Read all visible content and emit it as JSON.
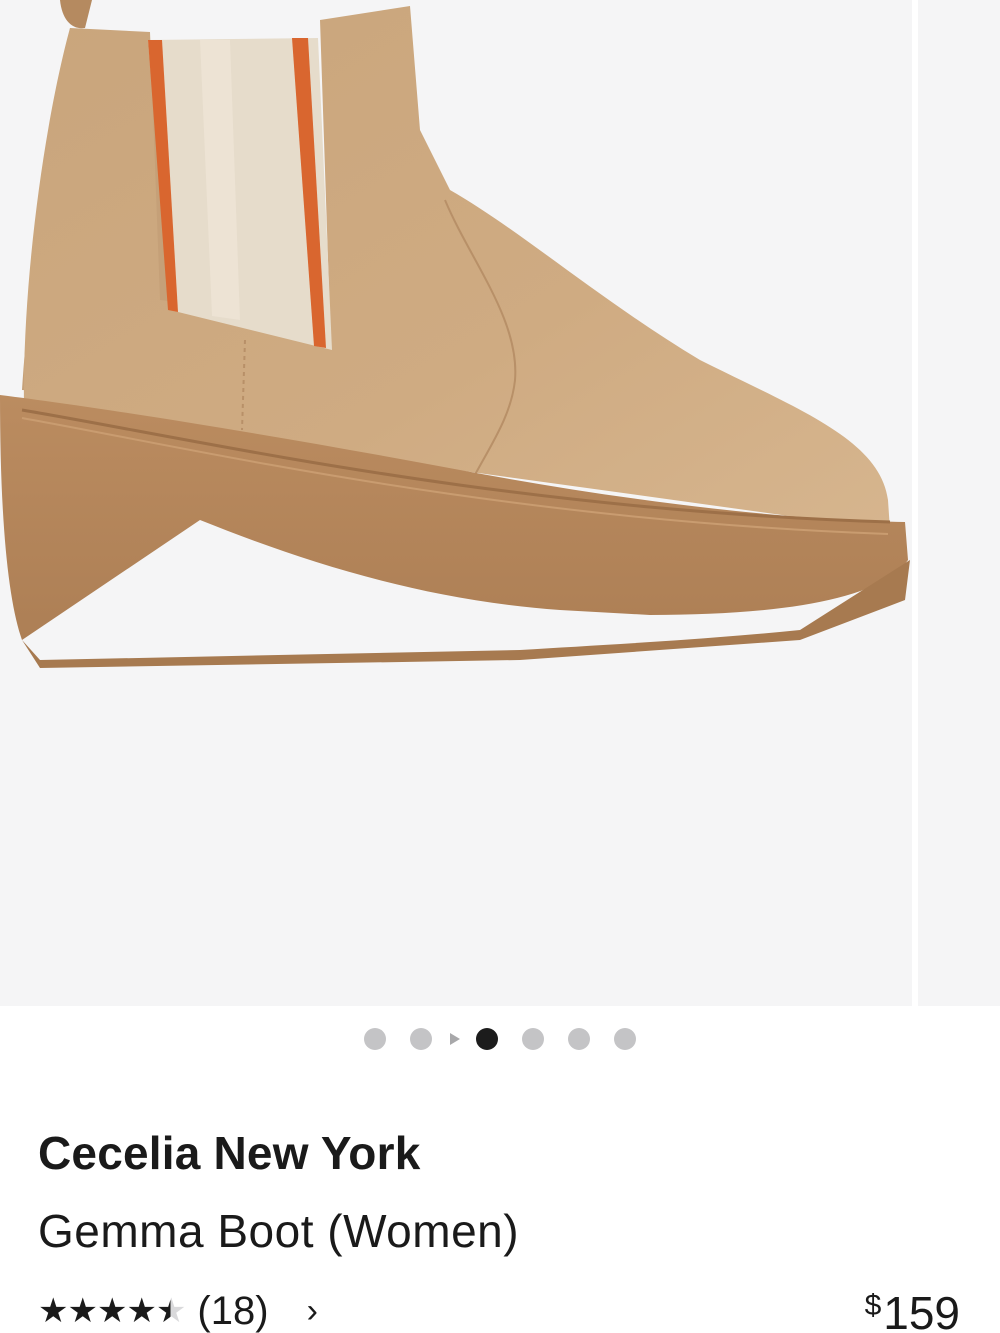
{
  "carousel": {
    "image_description_icon": "boot-product-image",
    "dots": [
      {
        "state": "inactive"
      },
      {
        "state": "inactive"
      },
      {
        "state": "video"
      },
      {
        "state": "active"
      },
      {
        "state": "inactive"
      },
      {
        "state": "inactive"
      },
      {
        "state": "inactive"
      }
    ]
  },
  "product": {
    "brand": "Cecelia New York",
    "name": "Gemma Boot (Women)",
    "rating": 4.5,
    "rating_max": 5,
    "review_count": "(18)",
    "price_symbol": "$",
    "price_value": "159"
  },
  "colors": {
    "background": "#ffffff",
    "image_background": "#f5f5f6",
    "suede": "#c9a57d",
    "sole": "#b6875c",
    "stripe_cream": "#e9dfcf",
    "stripe_orange": "#d9662f",
    "active_dot": "#1c1c1c",
    "inactive_dot": "#c4c4c6"
  }
}
